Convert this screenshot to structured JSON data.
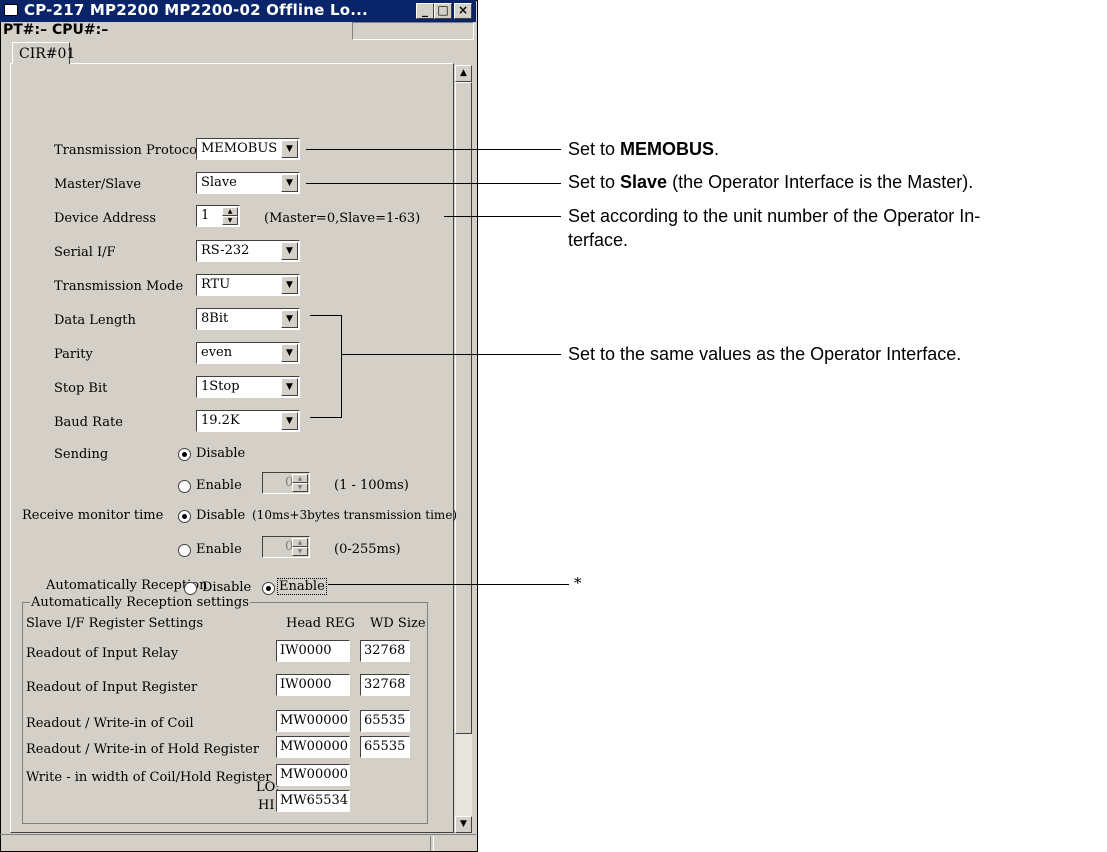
{
  "window": {
    "title": "CP-217   MP2200    MP2200-02 Offline  Lo...",
    "status_label": "PT#:– CPU#:–",
    "tab": "CIR#01"
  },
  "form": {
    "transmission_protocol": {
      "label": "Transmission Protocol",
      "value": "MEMOBUS"
    },
    "master_slave": {
      "label": "Master/Slave",
      "value": "Slave"
    },
    "device_address": {
      "label": "Device Address",
      "value": "1",
      "hint": "(Master=0,Slave=1-63)"
    },
    "serial_if": {
      "label": "Serial I/F",
      "value": "RS-232"
    },
    "transmission_mode": {
      "label": "Transmission Mode",
      "value": "RTU"
    },
    "data_length": {
      "label": "Data Length",
      "value": "8Bit"
    },
    "parity": {
      "label": "Parity",
      "value": "even"
    },
    "stop_bit": {
      "label": "Stop Bit",
      "value": "1Stop"
    },
    "baud_rate": {
      "label": "Baud Rate",
      "value": "19.2K"
    },
    "sending": {
      "label": "Sending",
      "disable": "Disable",
      "enable": "Enable",
      "spin_value": "0",
      "range": "(1 - 100ms)",
      "selected": "Disable"
    },
    "receive_monitor": {
      "label": "Receive monitor time",
      "disable": "Disable",
      "enable": "Enable",
      "spin_value": "0",
      "note": "(10ms+3bytes transmission time)",
      "range": "(0-255ms)",
      "selected": "Disable"
    },
    "auto_reception": {
      "label": "Automatically Reception",
      "disable": "Disable",
      "enable": "Enable",
      "selected": "Enable"
    }
  },
  "auto_settings": {
    "group_title": "Automatically Reception settings",
    "header_label": "Slave I/F Register Settings",
    "col_head": "Head REG",
    "col_size": "WD Size",
    "rows": [
      {
        "label": "Readout of Input Relay",
        "head": "IW0000",
        "size": "32768"
      },
      {
        "label": "Readout of Input Register",
        "head": "IW0000",
        "size": "32768"
      },
      {
        "label": "Readout / Write-in of Coil",
        "head": "MW00000",
        "size": "65535"
      },
      {
        "label": "Readout / Write-in of Hold Register",
        "head": "MW00000",
        "size": "65535"
      }
    ],
    "width_label": "Write - in width of Coil/Hold Register",
    "lo_label": "LO:",
    "lo_value": "MW00000",
    "hi_label": "HI:",
    "hi_value": "MW65534"
  },
  "annotations": {
    "a1_prefix": "Set to ",
    "a1_bold": "MEMOBUS",
    "a1_suffix": ".",
    "a2_prefix": "Set to ",
    "a2_bold": "Slave",
    "a2_suffix": " (the Operator Interface is the Master).",
    "a3_line1": "Set according to the unit number of the Operator In-",
    "a3_line2": "terface.",
    "a4": "Set to the same values as the Operator Interface.",
    "a5": "*"
  }
}
